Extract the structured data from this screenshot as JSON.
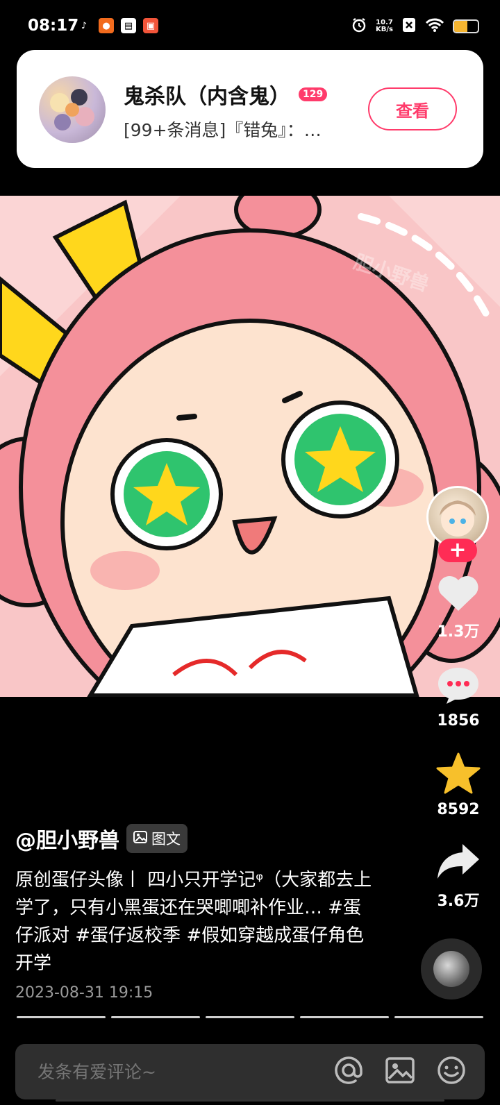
{
  "status_bar": {
    "time": "08:17",
    "net_speed_value": "10.7",
    "net_speed_unit": "KB/s",
    "battery_level": 0.55,
    "battery_color": "#f5b531"
  },
  "notification": {
    "title": "鬼杀队（内含鬼）",
    "badge": "129",
    "message": "[99+条消息]『错兔』：…",
    "action_label": "查看",
    "accent_color": "#ff3b6b"
  },
  "actions": {
    "like_count": "1.3万",
    "comment_count": "1856",
    "favorite_count": "8592",
    "share_count": "3.6万",
    "follow_symbol": "+"
  },
  "post": {
    "author": "@胆小野兽",
    "type_tag": "图文",
    "caption": "原创蛋仔头像丨 四小只开学记ᵠ（大家都去上学了，只有小黑蛋还在哭唧唧补作业… #蛋仔派对 #蛋仔返校季 #假如穿越成蛋仔角色开学",
    "date": "2023-08-31 19:15",
    "image_count": 5,
    "watermark": "胆小野兽"
  },
  "comment_bar": {
    "placeholder": "发条有爱评论~"
  }
}
